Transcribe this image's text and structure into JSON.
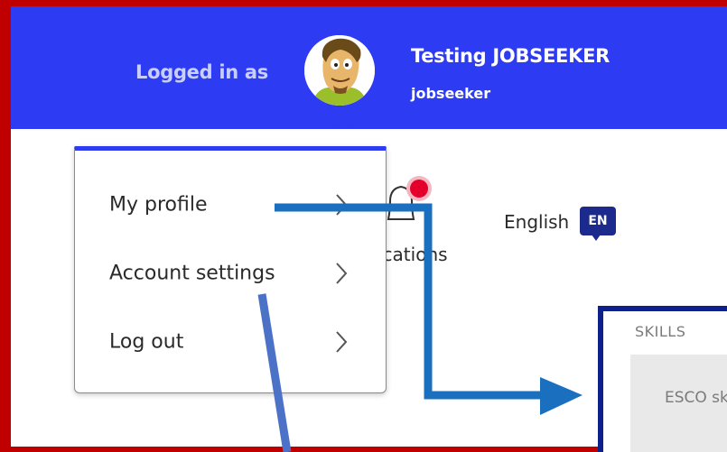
{
  "header": {
    "logged_in_label": "Logged in as",
    "user_name": "Testing JOBSEEKER",
    "user_role": "jobseeker",
    "background_color": "#2d3bf2"
  },
  "dropdown": {
    "items": [
      {
        "label": "My profile"
      },
      {
        "label": "Account settings"
      },
      {
        "label": "Log out"
      }
    ]
  },
  "notifications": {
    "label_visible": "ications"
  },
  "language": {
    "label": "English",
    "badge": "EN"
  },
  "skills": {
    "title": "SKILLS",
    "field_text": "ESCO sk"
  },
  "annotation": {
    "frame_color": "#c00000",
    "arrow_color": "#1a6fbf",
    "panel_border_color": "#10208a"
  }
}
